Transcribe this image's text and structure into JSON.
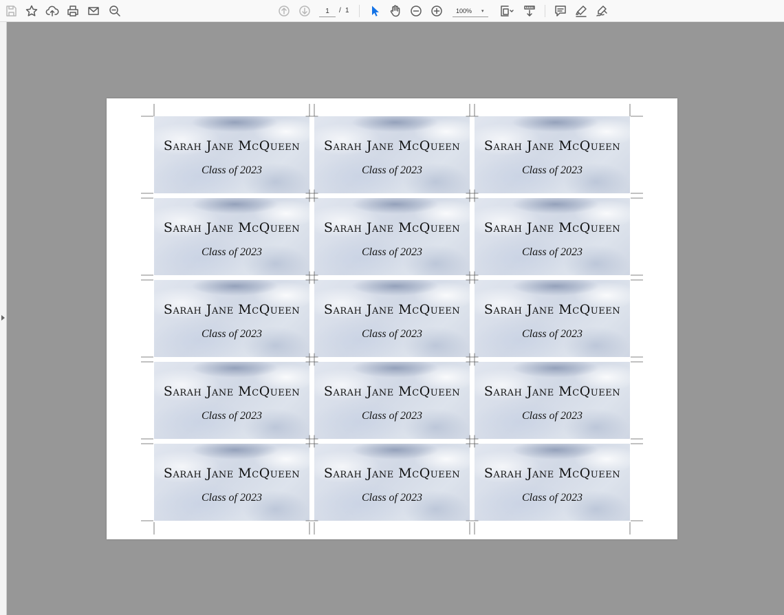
{
  "toolbar": {
    "page_current": "1",
    "page_separator": "/",
    "page_total": "1",
    "zoom": "100%",
    "zoom_caret": "▾",
    "icons": [
      "save-icon",
      "bookmark-star-icon",
      "upload-cloud-icon",
      "print-icon",
      "email-icon",
      "zoom-out-magnifier-icon",
      "previous-page-icon",
      "next-page-icon",
      "select-cursor-icon",
      "hand-tool-icon",
      "zoom-out-icon",
      "zoom-in-icon",
      "page-fit-icon",
      "scrolling-mode-icon",
      "comment-icon",
      "highlight-icon",
      "fill-sign-icon"
    ],
    "accent_color": "#1473e6"
  },
  "document": {
    "labels": [
      {
        "name": "Sarah Jane McQueen",
        "class": "Class of 2023"
      },
      {
        "name": "Sarah Jane McQueen",
        "class": "Class of 2023"
      },
      {
        "name": "Sarah Jane McQueen",
        "class": "Class of 2023"
      },
      {
        "name": "Sarah Jane McQueen",
        "class": "Class of 2023"
      },
      {
        "name": "Sarah Jane McQueen",
        "class": "Class of 2023"
      },
      {
        "name": "Sarah Jane McQueen",
        "class": "Class of 2023"
      },
      {
        "name": "Sarah Jane McQueen",
        "class": "Class of 2023"
      },
      {
        "name": "Sarah Jane McQueen",
        "class": "Class of 2023"
      },
      {
        "name": "Sarah Jane McQueen",
        "class": "Class of 2023"
      },
      {
        "name": "Sarah Jane McQueen",
        "class": "Class of 2023"
      },
      {
        "name": "Sarah Jane McQueen",
        "class": "Class of 2023"
      },
      {
        "name": "Sarah Jane McQueen",
        "class": "Class of 2023"
      },
      {
        "name": "Sarah Jane McQueen",
        "class": "Class of 2023"
      },
      {
        "name": "Sarah Jane McQueen",
        "class": "Class of 2023"
      },
      {
        "name": "Sarah Jane McQueen",
        "class": "Class of 2023"
      }
    ]
  }
}
